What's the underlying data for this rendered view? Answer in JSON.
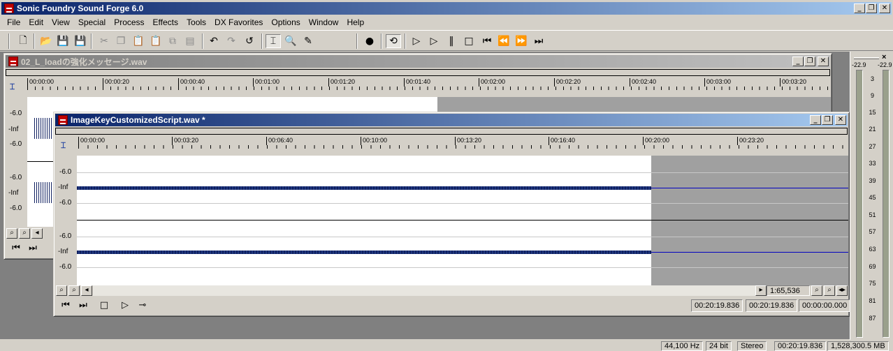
{
  "app": {
    "title": "Sonic Foundry Sound Forge 6.0",
    "window_buttons": {
      "minimize": "_",
      "restore": "❐",
      "close": "✕"
    }
  },
  "menu": [
    "File",
    "Edit",
    "View",
    "Special",
    "Process",
    "Effects",
    "Tools",
    "DX Favorites",
    "Options",
    "Window",
    "Help"
  ],
  "toolbar": {
    "icons": [
      "new-file-icon",
      "open-icon",
      "save-icon",
      "save-all-icon",
      "cut-icon",
      "copy-icon",
      "paste-icon",
      "mix-icon",
      "crop-icon",
      "trim-icon",
      "undo-icon",
      "redo-icon",
      "repeat-icon",
      "edit-tool-icon",
      "magnify-tool-icon",
      "pencil-tool-icon",
      "record-icon",
      "loop-icon",
      "play-all-icon",
      "play-icon",
      "pause-icon",
      "stop-icon",
      "go-start-icon",
      "rewind-icon",
      "fast-forward-icon",
      "go-end-icon"
    ]
  },
  "back_window": {
    "title": "02_L_loadの強化メッセージ.wav",
    "ruler": [
      "00:00:00",
      "00:00:20",
      "00:00:40",
      "00:01:00",
      "00:01:20",
      "00:01:40",
      "00:02:00",
      "00:02:20",
      "00:02:40",
      "00:03:00",
      "00:03:20"
    ],
    "db_labels": [
      "-6.0",
      "-Inf",
      "-6.0",
      "-6.0",
      "-Inf",
      "-6.0"
    ]
  },
  "front_window": {
    "title": "ImageKeyCustomizedScript.wav *",
    "ruler": [
      "00:00:00",
      "00:03:20",
      "00:06:40",
      "00:10:00",
      "00:13:20",
      "00:16:40",
      "00:20:00",
      "00:23:20"
    ],
    "db_labels": [
      "-6.0",
      "-Inf",
      "-6.0",
      "-6.0",
      "-Inf",
      "-6.0"
    ],
    "zoom_ratio": "1:65,536",
    "selection_start": "00:20:19.836",
    "selection_end": "00:20:19.836",
    "selection_length": "00:00:00.000"
  },
  "meters": {
    "peak_left": "-22.9",
    "peak_right": "-22.9",
    "scale": [
      "3",
      "9",
      "15",
      "21",
      "27",
      "33",
      "39",
      "45",
      "51",
      "57",
      "63",
      "69",
      "75",
      "81",
      "87"
    ],
    "close": "×"
  },
  "status": {
    "sample_rate": "44,100 Hz",
    "bit_depth": "24 bit",
    "channels": "Stereo",
    "length": "00:20:19.836",
    "disk_space": "1,528,300.5 MB"
  }
}
